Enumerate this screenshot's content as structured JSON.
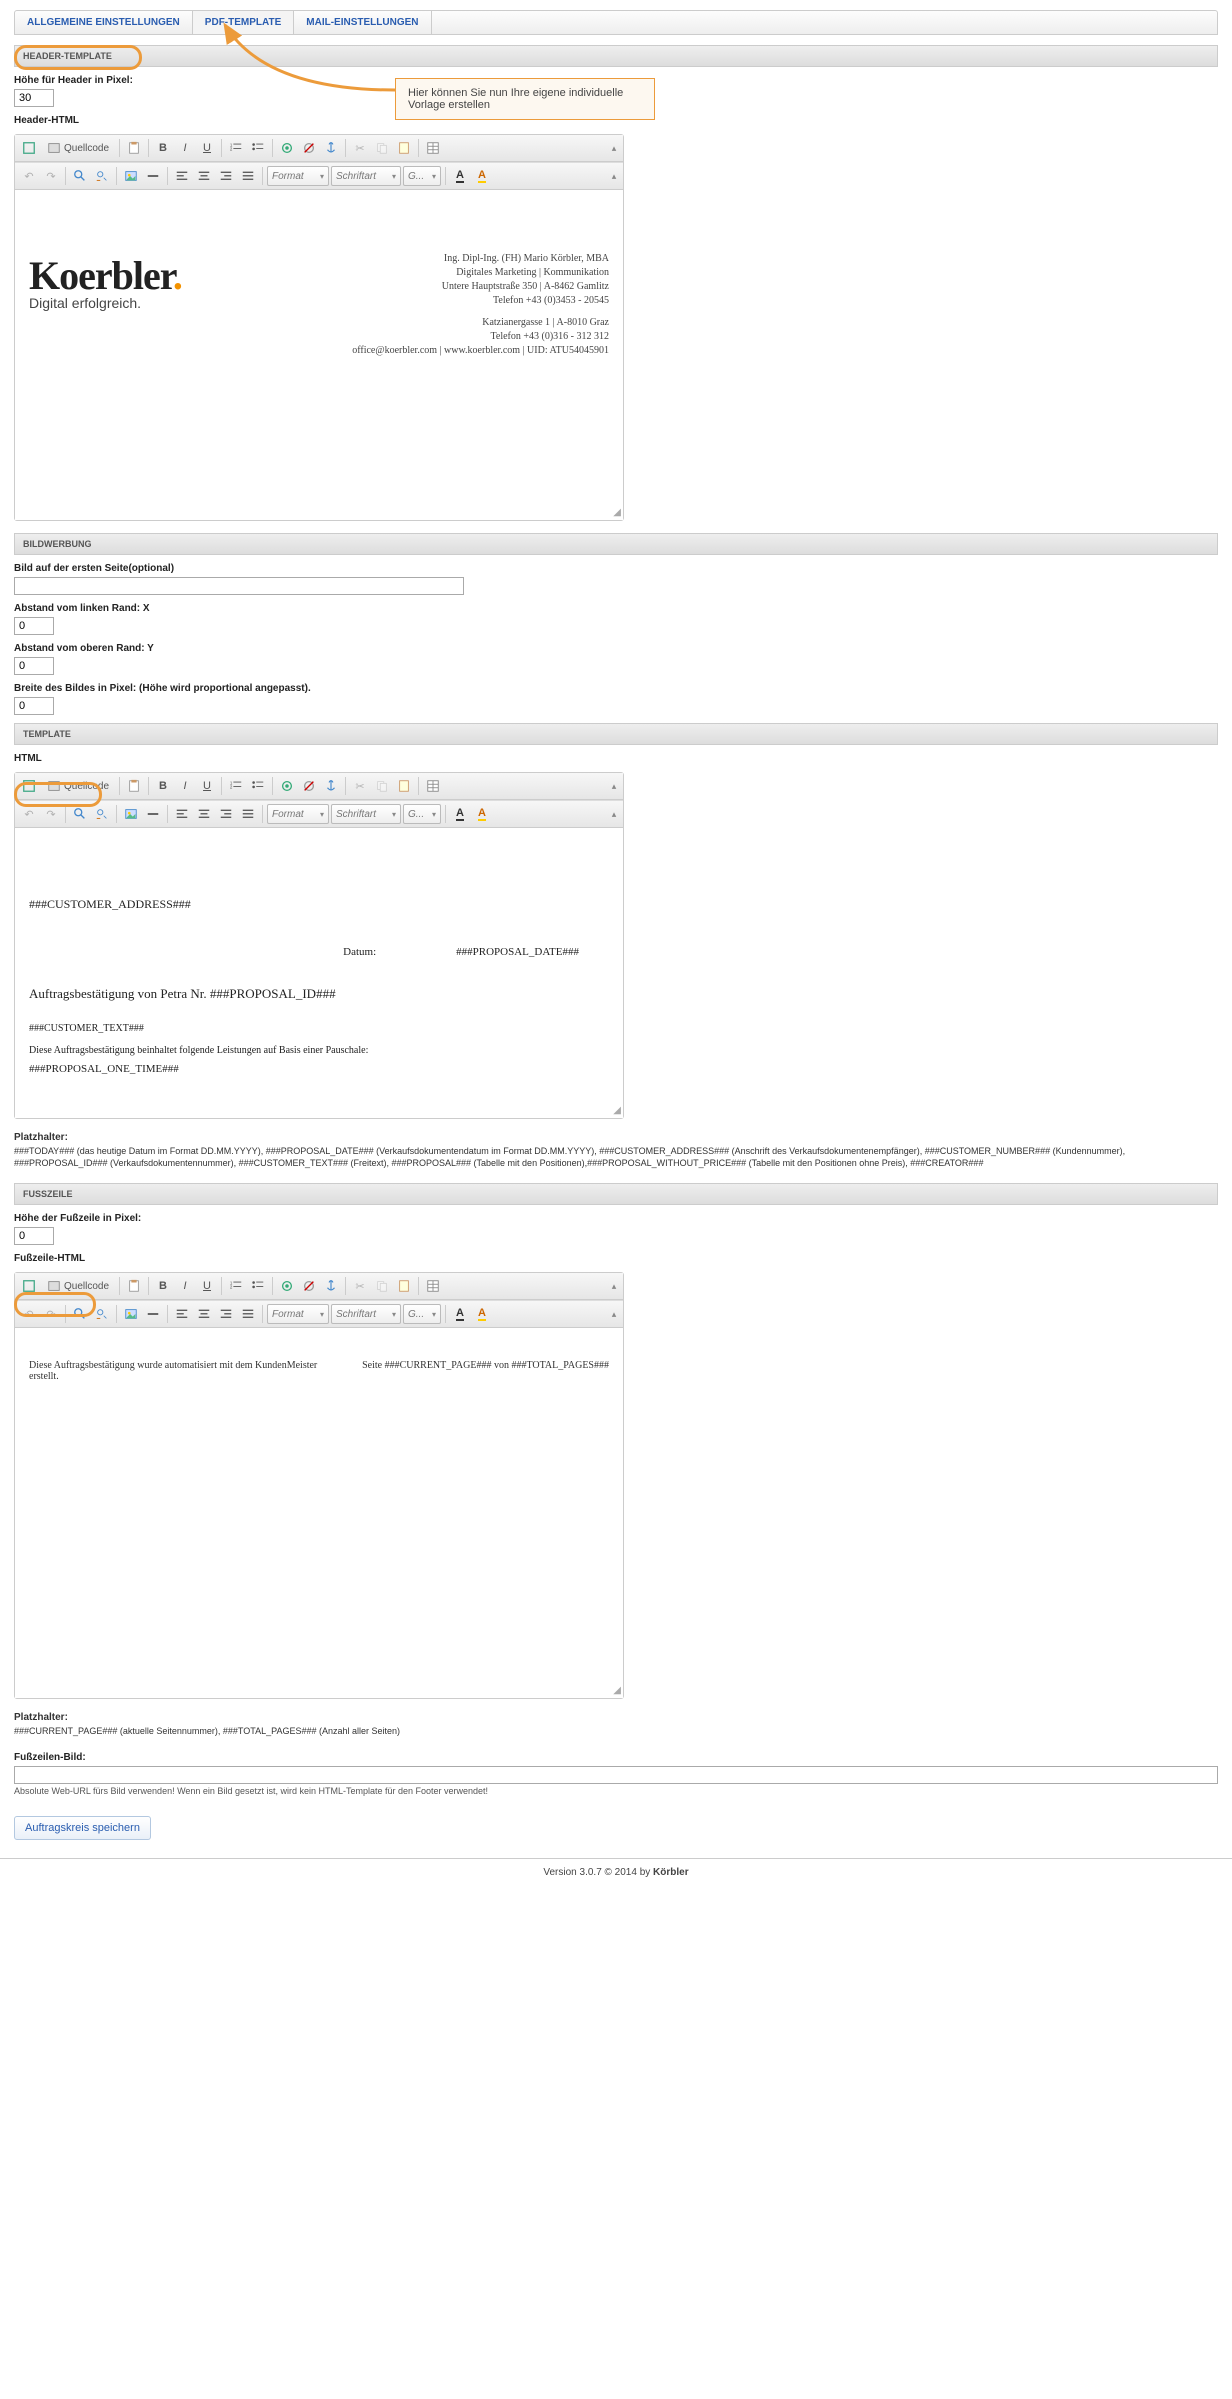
{
  "tabs": {
    "general": "ALLGEMEINE EINSTELLUNGEN",
    "pdf": "PDF-TEMPLATE",
    "mail": "MAIL-EINSTELLUNGEN"
  },
  "callout": "Hier können Sie nun Ihre eigene individuelle Vorlage erstellen",
  "sections": {
    "header": "HEADER-TEMPLATE",
    "imagead": "BILDWERBUNG",
    "template": "TEMPLATE",
    "footer": "FUSSZEILE"
  },
  "header": {
    "heightLabel": "Höhe für Header in Pixel:",
    "heightValue": "30",
    "htmlLabel": "Header-HTML"
  },
  "editorToolbar": {
    "source": "Quellcode",
    "format": "Format",
    "font": "Schriftart",
    "size": "G..."
  },
  "headerPreview": {
    "logo": "Koerbler",
    "sub": "Digital erfolgreich.",
    "line1": "Ing. Dipl-Ing. (FH) Mario Körbler, MBA",
    "line2": "Digitales Marketing | Kommunikation",
    "line3": "Untere Hauptstraße 350 | A-8462 Gamlitz",
    "line4": "Telefon +43 (0)3453 - 20545",
    "line5": "Katzianergasse 1 | A-8010 Graz",
    "line6": "Telefon +43 (0)316 - 312 312",
    "line7": "office@koerbler.com | www.koerbler.com | UID: ATU54045901"
  },
  "imagead": {
    "firstPageLabel": "Bild auf der ersten Seite(optional)",
    "marginLeftLabel": "Abstand vom linken Rand: X",
    "marginLeftValue": "0",
    "marginTopLabel": "Abstand vom oberen Rand: Y",
    "marginTopValue": "0",
    "widthLabel": "Breite des Bildes in Pixel: (Höhe wird proportional angepasst).",
    "widthValue": "0"
  },
  "template": {
    "htmlLabel": "HTML",
    "addr": "###CUSTOMER_ADDRESS###",
    "dateLabel": "Datum:",
    "dateValue": "###PROPOSAL_DATE###",
    "order": "Auftragsbestätigung von Petra Nr. ###PROPOSAL_ID###",
    "ct": "###CUSTOMER_TEXT###",
    "body": "Diese Auftragsbestätigung beinhaltet folgende Leistungen auf Basis einer Pauschale:",
    "one": "###PROPOSAL_ONE_TIME###",
    "phTitle": "Platzhalter:",
    "phText": "###TODAY### (das heutige Datum im Format DD.MM.YYYY), ###PROPOSAL_DATE### (Verkaufsdokumentendatum im Format DD.MM.YYYY), ###CUSTOMER_ADDRESS### (Anschrift des Verkaufsdokumentenempfänger), ###CUSTOMER_NUMBER### (Kundennummer), ###PROPOSAL_ID### (Verkaufsdokumentennummer), ###CUSTOMER_TEXT### (Freitext), ###PROPOSAL### (Tabelle mit den Positionen),###PROPOSAL_WITHOUT_PRICE### (Tabelle mit den Positionen ohne Preis), ###CREATOR###"
  },
  "footer": {
    "heightLabel": "Höhe der Fußzeile in Pixel:",
    "heightValue": "0",
    "htmlLabel": "Fußzeile-HTML",
    "leftText": "Diese Auftragsbestätigung wurde automatisiert mit dem KundenMeister erstellt.",
    "rightText": "Seite ###CURRENT_PAGE### von ###TOTAL_PAGES###",
    "phTitle": "Platzhalter:",
    "phText": "###CURRENT_PAGE### (aktuelle Seitennummer), ###TOTAL_PAGES### (Anzahl aller Seiten)",
    "imageLabel": "Fußzeilen-Bild:",
    "imageHint": "Absolute Web-URL fürs Bild verwenden! Wenn ein Bild gesetzt ist, wird kein HTML-Template für den Footer verwendet!"
  },
  "save": "Auftragskreis speichern",
  "pageFooter": {
    "version": "Version 3.0.7 © 2014 by ",
    "brand": "Körbler"
  }
}
